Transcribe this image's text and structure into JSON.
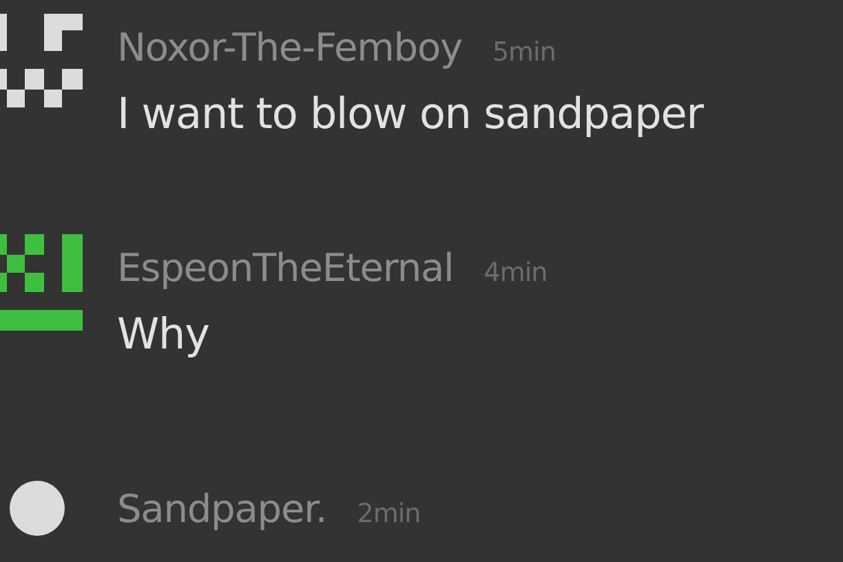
{
  "comments": [
    {
      "author": "Noxor-The-Femboy",
      "time": "5min",
      "message": "I want to blow on sandpaper",
      "avatar": {
        "kind": "pixel-face",
        "color": "#dcdcdc"
      }
    },
    {
      "author": "EspeonTheEternal",
      "time": "4min",
      "message": "Why",
      "avatar": {
        "kind": "pixel-bars",
        "color": "#3fbf3f"
      }
    },
    {
      "author": "Sandpaper.",
      "time": "2min",
      "avatar": {
        "kind": "circle",
        "color": "#dcdcdc"
      }
    }
  ]
}
